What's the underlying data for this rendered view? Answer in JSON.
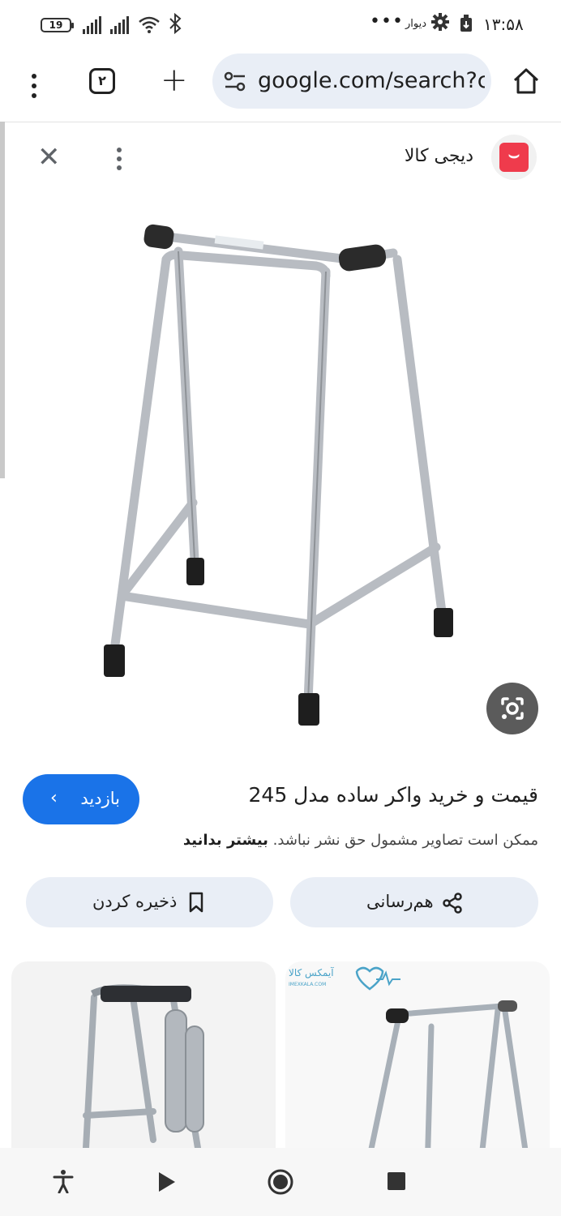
{
  "status_bar": {
    "battery": "19",
    "more": "•••",
    "divar": "دیوار",
    "time": "۱۳:۵۸"
  },
  "toolbar": {
    "tab_count": "۲",
    "url": "google.com/search?c"
  },
  "result": {
    "source_name": "دیجی کالا",
    "title": "قیمت و خرید واکر ساده مدل 245",
    "visit_label": "بازدید",
    "copyright_text": "ممکن است تصاویر مشمول حق نشر نباشد.",
    "learn_more": "بیشتر بدانید"
  },
  "actions": {
    "share_label": "هم‌رسانی",
    "save_label": "ذخیره کردن"
  },
  "related": {
    "right_logo_text": "آیمکس کالا",
    "right_logo_sub": "IMEXKALA.COM"
  },
  "colors": {
    "accent": "#1a73e8",
    "brand": "#ef3b4c",
    "pill": "#e9eef6"
  }
}
